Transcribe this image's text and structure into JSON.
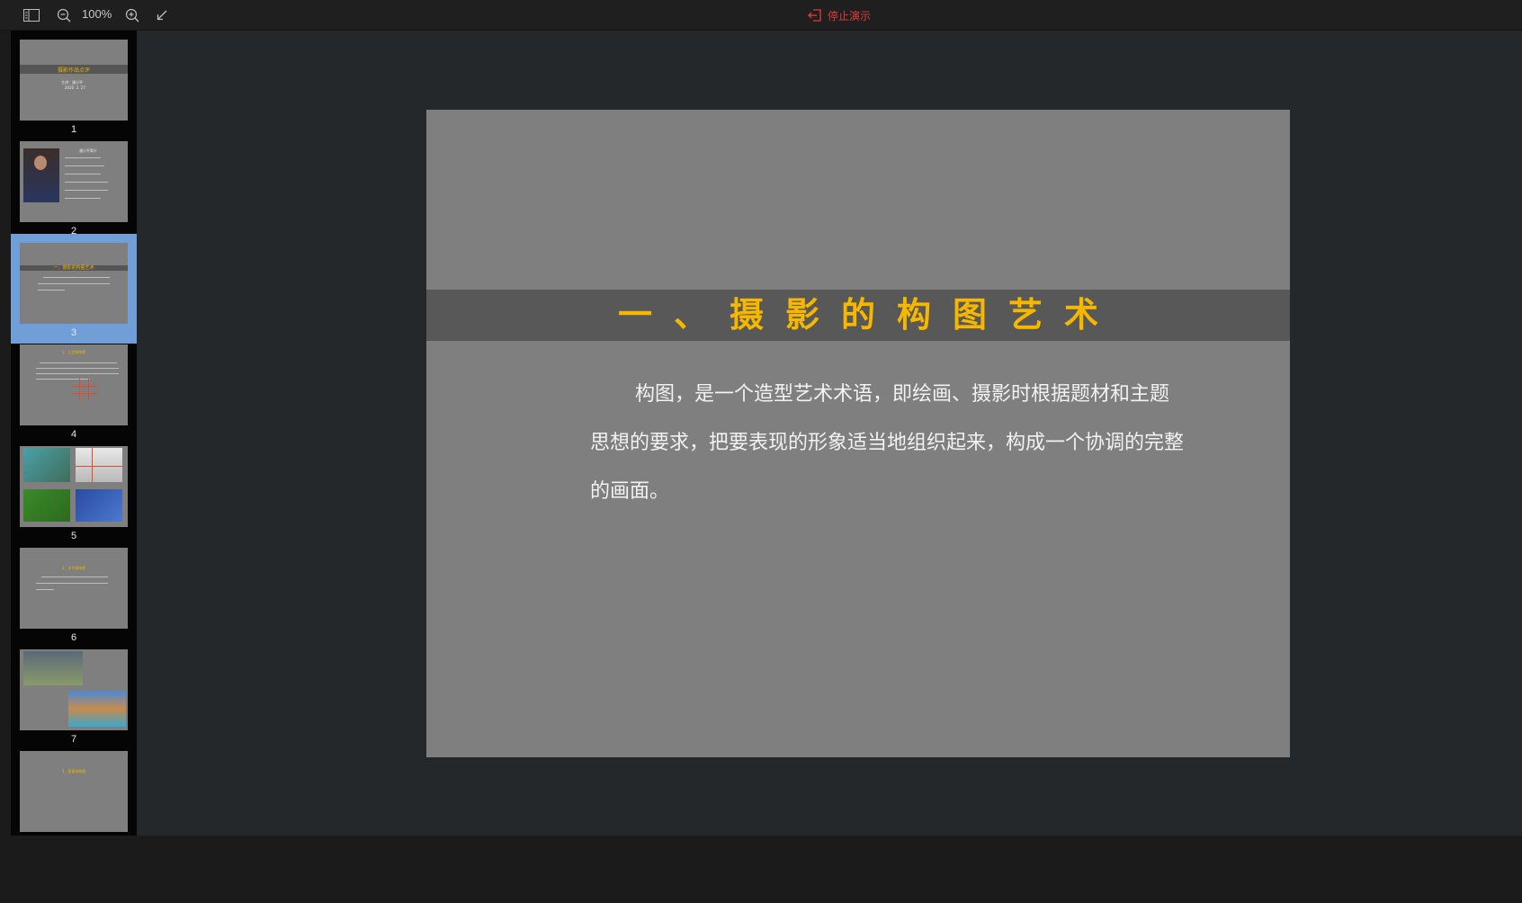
{
  "toolbar": {
    "sidebar_toggle_icon": "sidebar-icon",
    "zoom_out_icon": "zoom-out-icon",
    "zoom_level": "100%",
    "zoom_in_icon": "zoom-in-icon",
    "exit_fullscreen_icon": "collapse-arrow-icon",
    "stop_label": "停止演示",
    "stop_icon": "exit-icon",
    "stop_color": "#e23b3b"
  },
  "thumbnails": [
    {
      "number": "1",
      "title": "摄影作品点评",
      "lines": [
        "主讲：潘小平",
        "2020. 2. 27"
      ]
    },
    {
      "number": "2",
      "title": "潘小平简介"
    },
    {
      "number": "3",
      "title": "一、摄影的构图艺术",
      "active": true
    },
    {
      "number": "4",
      "title": "1、九宫格构图"
    },
    {
      "number": "5"
    },
    {
      "number": "6",
      "title": "2、水平线构图"
    },
    {
      "number": "7"
    },
    {
      "number": "8",
      "title": "3、垂直线构图"
    }
  ],
  "slide": {
    "title": "一、摄影的构图艺术",
    "body": "构图，是一个造型艺术术语，即绘画、摄影时根据题材和主题思想的要求，把要表现的形象适当地组织起来，构成一个协调的完整的画面。",
    "title_color": "#f5b700",
    "background": "#7f7f7f"
  }
}
